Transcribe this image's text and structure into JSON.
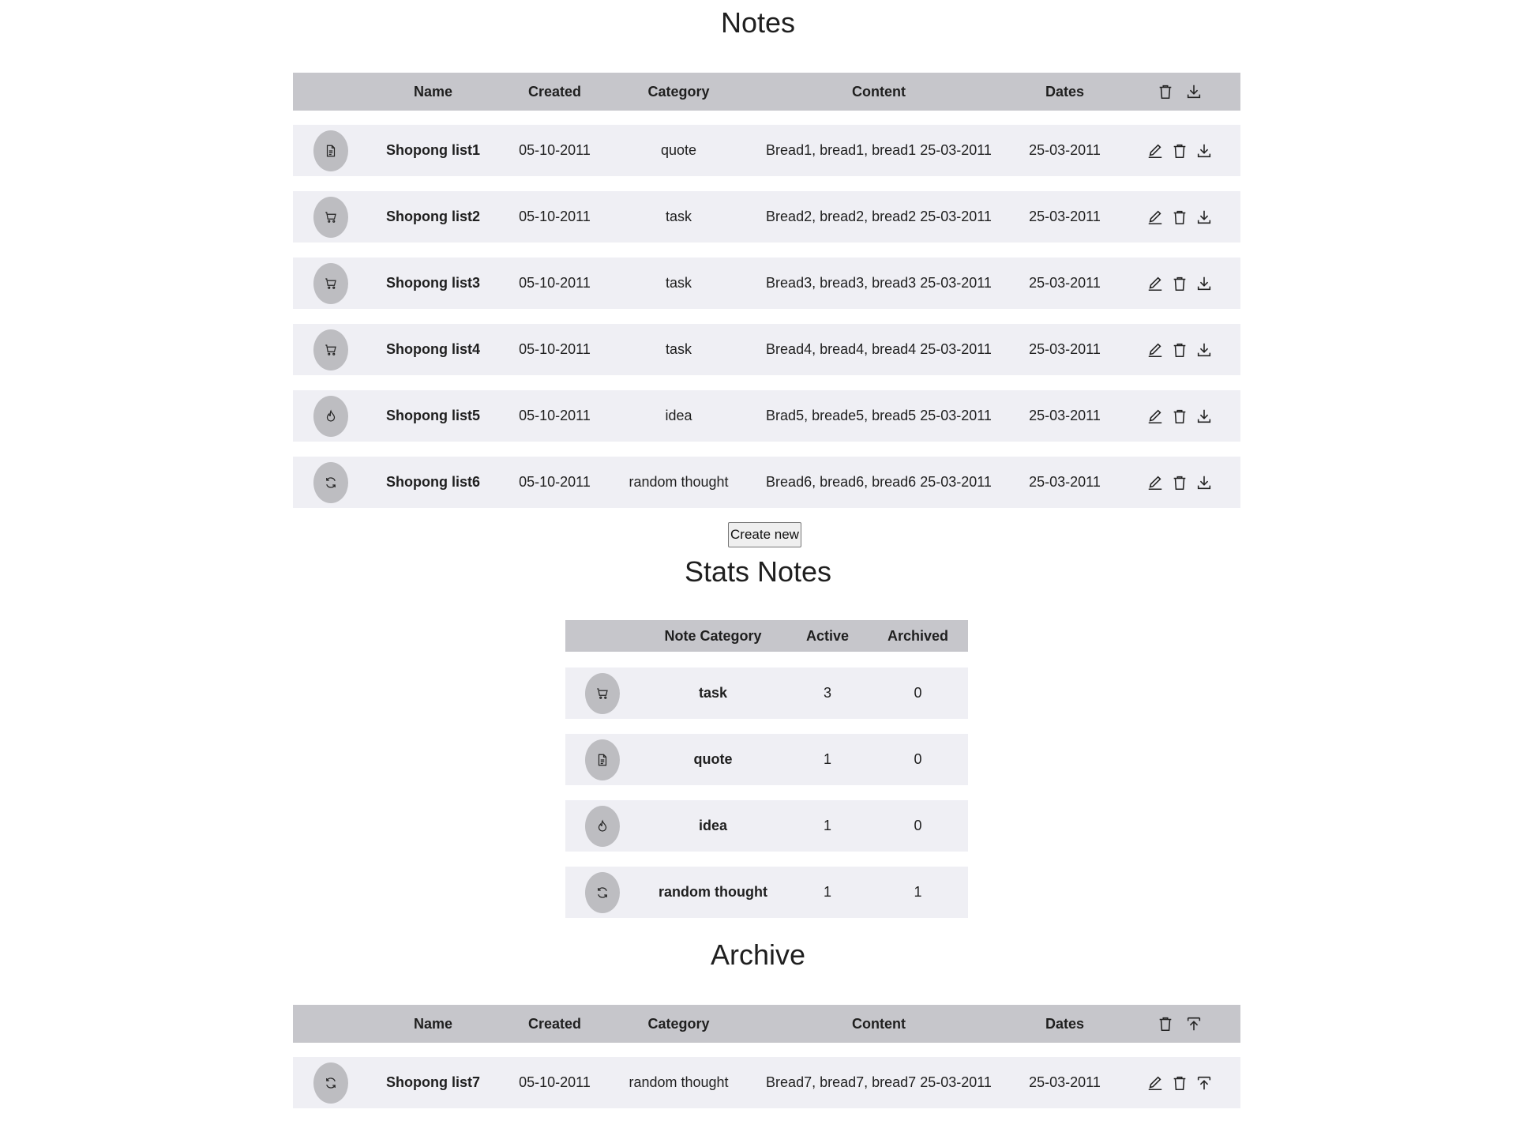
{
  "notes": {
    "title": "Notes",
    "headers": {
      "name": "Name",
      "created": "Created",
      "category": "Category",
      "content": "Content",
      "dates": "Dates"
    },
    "header_icons": [
      "trash-icon",
      "download-icon"
    ],
    "rows": [
      {
        "icon": "document-icon",
        "name": "Shopong list1",
        "created": "05-10-2011",
        "category": "quote",
        "content": "Bread1, bread1, bread1 25-03-2011",
        "dates": "25-03-2011"
      },
      {
        "icon": "cart-icon",
        "name": "Shopong list2",
        "created": "05-10-2011",
        "category": "task",
        "content": "Bread2, bread2, bread2 25-03-2011",
        "dates": "25-03-2011"
      },
      {
        "icon": "cart-icon",
        "name": "Shopong list3",
        "created": "05-10-2011",
        "category": "task",
        "content": "Bread3, bread3, bread3 25-03-2011",
        "dates": "25-03-2011"
      },
      {
        "icon": "cart-icon",
        "name": "Shopong list4",
        "created": "05-10-2011",
        "category": "task",
        "content": "Bread4, bread4, bread4 25-03-2011",
        "dates": "25-03-2011"
      },
      {
        "icon": "flame-icon",
        "name": "Shopong list5",
        "created": "05-10-2011",
        "category": "idea",
        "content": "Brad5, breade5, bread5 25-03-2011",
        "dates": "25-03-2011"
      },
      {
        "icon": "refresh-icon",
        "name": "Shopong list6",
        "created": "05-10-2011",
        "category": "random thought",
        "content": "Bread6, bread6, bread6 25-03-2011",
        "dates": "25-03-2011"
      }
    ],
    "row_icons": [
      "edit-icon",
      "trash-icon",
      "download-icon"
    ],
    "create_label": "Create new"
  },
  "stats": {
    "title": "Stats Notes",
    "headers": {
      "category": "Note Category",
      "active": "Active",
      "archived": "Archived"
    },
    "rows": [
      {
        "icon": "cart-icon",
        "category": "task",
        "active": "3",
        "archived": "0"
      },
      {
        "icon": "document-icon",
        "category": "quote",
        "active": "1",
        "archived": "0"
      },
      {
        "icon": "flame-icon",
        "category": "idea",
        "active": "1",
        "archived": "0"
      },
      {
        "icon": "refresh-icon",
        "category": "random thought",
        "active": "1",
        "archived": "1"
      }
    ]
  },
  "archive": {
    "title": "Archive",
    "headers": {
      "name": "Name",
      "created": "Created",
      "category": "Category",
      "content": "Content",
      "dates": "Dates"
    },
    "header_icons": [
      "trash-icon",
      "unarchive-icon"
    ],
    "rows": [
      {
        "icon": "refresh-icon",
        "name": "Shopong list7",
        "created": "05-10-2011",
        "category": "random thought",
        "content": "Bread7, bread7, bread7 25-03-2011",
        "dates": "25-03-2011"
      }
    ],
    "row_icons": [
      "edit-icon",
      "trash-icon",
      "unarchive-icon"
    ]
  },
  "colors": {
    "header_bg": "#c6c6cb",
    "row_bg": "#efeff4",
    "icon_circle": "#bdbdc1"
  }
}
